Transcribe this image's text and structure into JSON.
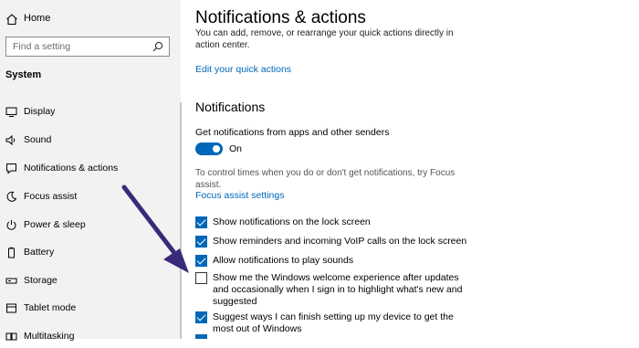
{
  "sidebar": {
    "home_label": "Home",
    "search": {
      "placeholder": "Find a setting"
    },
    "section_title": "System",
    "items": [
      {
        "label": "Display",
        "icon": "display-icon"
      },
      {
        "label": "Sound",
        "icon": "speaker-icon"
      },
      {
        "label": "Notifications & actions",
        "icon": "notification-icon"
      },
      {
        "label": "Focus assist",
        "icon": "moon-icon"
      },
      {
        "label": "Power & sleep",
        "icon": "power-icon"
      },
      {
        "label": "Battery",
        "icon": "battery-icon"
      },
      {
        "label": "Storage",
        "icon": "storage-icon"
      },
      {
        "label": "Tablet mode",
        "icon": "tablet-icon"
      },
      {
        "label": "Multitasking",
        "icon": "multitasking-icon"
      }
    ]
  },
  "main": {
    "title": "Notifications & actions",
    "quick_actions_text": "You can add, remove, or rearrange your quick actions directly in action center.",
    "edit_quick_actions_link": "Edit your quick actions",
    "notifications_heading": "Notifications",
    "get_notifications_label": "Get notifications from apps and other senders",
    "toggle_state": "On",
    "focus_text": "To control times when you do or don't get notifications, try Focus assist.",
    "focus_link": "Focus assist settings",
    "checkboxes": [
      {
        "label": "Show notifications on the lock screen",
        "checked": true
      },
      {
        "label": "Show reminders and incoming VoIP calls on the lock screen",
        "checked": true
      },
      {
        "label": "Allow notifications to play sounds",
        "checked": true
      },
      {
        "label": "Show me the Windows welcome experience after updates and occasionally when I sign in to highlight what's new and suggested",
        "checked": false
      },
      {
        "label": "Suggest ways I can finish setting up my device to get the most out of Windows",
        "checked": true
      }
    ]
  },
  "colors": {
    "accent": "#0067b8",
    "sidebar_bg": "#f2f2f2",
    "annotation_arrow": "#3b2a7a"
  }
}
